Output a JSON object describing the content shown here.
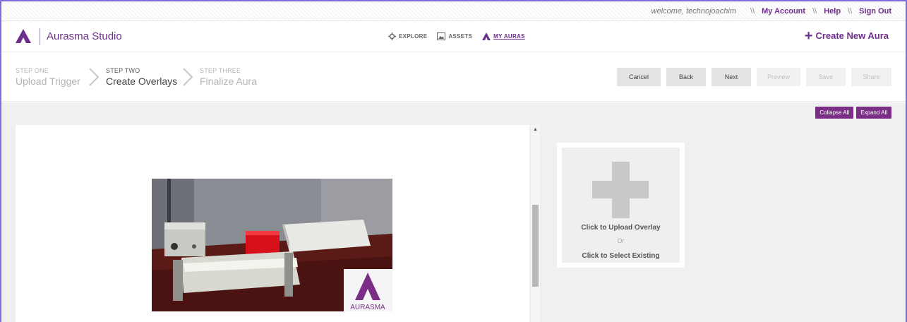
{
  "topbar": {
    "welcome": "welcome, technojoachim",
    "separator": "\\\\",
    "my_account": "My Account",
    "help": "Help",
    "sign_out": "Sign Out"
  },
  "header": {
    "brand": "Aurasma Studio",
    "nav": [
      {
        "label": "EXPLORE",
        "icon": "crosshair-icon"
      },
      {
        "label": "ASSETS",
        "icon": "image-icon"
      },
      {
        "label": "MY AURAS",
        "icon": "aurasma-logo-icon"
      }
    ],
    "create_new": "Create New Aura",
    "accent": "#6d2f8c"
  },
  "steps": [
    {
      "small": "STEP ONE",
      "big": "Upload Trigger"
    },
    {
      "small": "STEP TWO",
      "big": "Create Overlays"
    },
    {
      "small": "STEP THREE",
      "big": "Finalize Aura"
    }
  ],
  "actions": {
    "cancel": "Cancel",
    "back": "Back",
    "next": "Next",
    "preview": "Preview",
    "save": "Save",
    "share": "Share"
  },
  "workspace": {
    "collapse_all": "Collapse All",
    "expand_all": "Expand All",
    "watermark": "AURASMA",
    "upload_overlay": "Click to Upload Overlay",
    "or": "Or",
    "select_existing": "Click to Select Existing"
  }
}
